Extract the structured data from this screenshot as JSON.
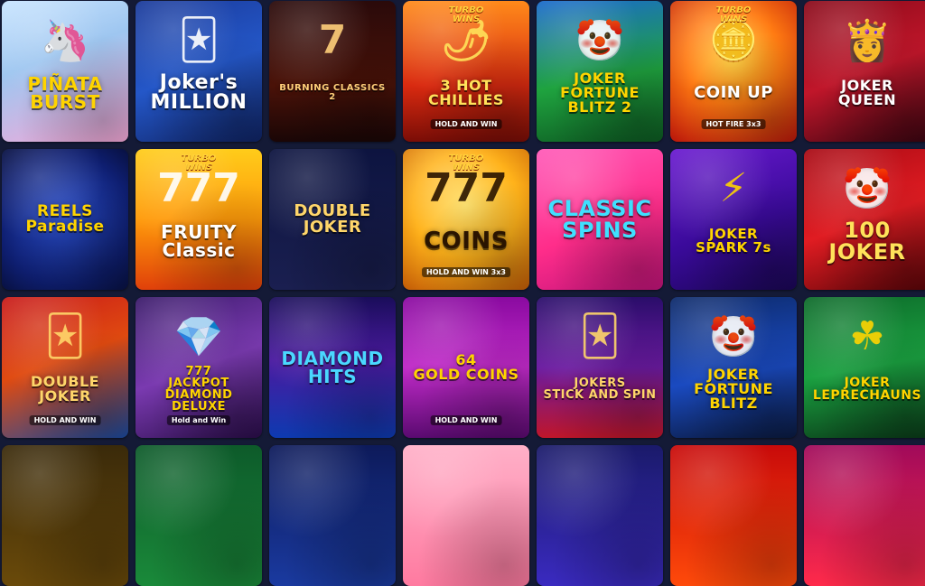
{
  "games": [
    {
      "title": "PIÑATA\nBURST",
      "badge": "",
      "sub": "",
      "bg": "linear-gradient(160deg,#c8e4ff 0%,#9ec6f0 40%,#f6a8d8 100%)",
      "fg": "#ffd400",
      "size": 20,
      "icon": "piñata-icon",
      "glyph": "🦄"
    },
    {
      "title": "Joker's\nMILLION",
      "badge": "",
      "sub": "",
      "bg": "linear-gradient(160deg,#1a3a9a 0%,#2457c8 50%,#0f2364 100%)",
      "fg": "#ffffff",
      "size": 22,
      "icon": "jester-icon",
      "glyph": "🃏"
    },
    {
      "title": "BURNING CLASSICS 2",
      "badge": "",
      "sub": "",
      "bg": "linear-gradient(180deg,#2a0a0a 0%,#4a1208 60%,#1a0606 100%)",
      "fg": "#ffcf7a",
      "size": 10,
      "icon": "sevens-icon",
      "glyph": "7"
    },
    {
      "title": "3 HOT\nCHILLIES",
      "badge": "TURBO\nWINS",
      "sub": "HOLD AND WIN",
      "bg": "linear-gradient(180deg,#ff8a1a 0%,#d92a10 60%,#7a0d06 100%)",
      "fg": "#ffe25a",
      "size": 16,
      "icon": "chili-icon",
      "glyph": "🌶"
    },
    {
      "title": "JOKER\nFORTUNE\nBLITZ 2",
      "badge": "",
      "sub": "",
      "bg": "linear-gradient(170deg,#1a6acc 0%,#1fa33f 55%,#0d5a22 100%)",
      "fg": "#ffd400",
      "size": 16,
      "icon": "jester-icon",
      "glyph": "🤡"
    },
    {
      "title": "COIN UP",
      "badge": "TURBO\nWINS",
      "sub": "HOT FIRE 3x3",
      "bg": "radial-gradient(circle at 50% 40%,#ffd23a 0%,#ff7a12 45%,#b8140a 100%)",
      "fg": "#ffffff",
      "size": 18,
      "icon": "coin-icon",
      "glyph": "🪙"
    },
    {
      "title": "JOKER\nQUEEN",
      "badge": "",
      "sub": "",
      "bg": "linear-gradient(160deg,#8a0a1a 0%,#c0162a 50%,#3a0410 100%)",
      "fg": "#ffffff",
      "size": 16,
      "icon": "queen-icon",
      "glyph": "👸"
    },
    {
      "title": "REELS\nParadise",
      "badge": "",
      "sub": "",
      "bg": "radial-gradient(circle at 50% 50%,#2a4fd0 0%,#0e1e70 70%,#081040 100%)",
      "fg": "#ffd400",
      "size": 17,
      "icon": "reel-icon",
      "glyph": ""
    },
    {
      "title": "FRUITY\nClassic",
      "badge": "TURBO\nWINS",
      "sub": "",
      "bg": "linear-gradient(180deg,#ffcc1a 0%,#ff9a0a 50%,#e0400a 100%)",
      "fg": "#ffffff",
      "size": 20,
      "icon": "sevens-icon",
      "glyph": "777"
    },
    {
      "title": "DOUBLE\nJOKER",
      "badge": "",
      "sub": "",
      "bg": "linear-gradient(180deg,#0d1440 0%,#1a1f50 100%)",
      "fg": "#ffd66a",
      "size": 18,
      "icon": "jester-icon",
      "glyph": ""
    },
    {
      "title": "COINS",
      "badge": "TURBO\nWINS",
      "sub": "HOLD AND WIN 3x3",
      "bg": "radial-gradient(circle at 50% 40%,#ffe066 0%,#ffb21a 50%,#c25a06 100%)",
      "fg": "#2a1400",
      "size": 26,
      "icon": "coin-icon",
      "glyph": "777"
    },
    {
      "title": "CLASSIC\nSPINS",
      "badge": "",
      "sub": "",
      "bg": "linear-gradient(160deg,#ff5ab8 0%,#ff2d8a 55%,#c2137a 100%)",
      "fg": "#3fe0ff",
      "size": 24,
      "icon": "spin-icon",
      "glyph": ""
    },
    {
      "title": "JOKER\nSPARK 7s",
      "badge": "",
      "sub": "",
      "bg": "linear-gradient(160deg,#6a1ad0 0%,#3a0a9a 55%,#1a0656 100%)",
      "fg": "#ffd400",
      "size": 15,
      "icon": "jester-icon",
      "glyph": "⚡"
    },
    {
      "title": "100\nJOKER",
      "badge": "",
      "sub": "",
      "bg": "linear-gradient(160deg,#a80a14 0%,#e01c22 50%,#5a0408 100%)",
      "fg": "#ffe25a",
      "size": 24,
      "icon": "clown-icon",
      "glyph": "🤡"
    },
    {
      "title": "DOUBLE\nJOKER",
      "badge": "",
      "sub": "HOLD AND WIN",
      "bg": "linear-gradient(160deg,#c81a1a 0%,#e04a10 45%,#1a4aa0 100%)",
      "fg": "#ffd66a",
      "size": 16,
      "icon": "jester-icon",
      "glyph": "🃏"
    },
    {
      "title": "777\nJACKPOT\nDIAMOND\nDELUXE",
      "badge": "",
      "sub": "Hold and Win",
      "bg": "linear-gradient(160deg,#3a1a6a 0%,#7a3ab0 50%,#2a0d4a 100%)",
      "fg": "#ffd400",
      "size": 13,
      "icon": "diamond-icon",
      "glyph": "💎"
    },
    {
      "title": "DIAMOND\nHITS",
      "badge": "",
      "sub": "",
      "bg": "linear-gradient(180deg,#1a0d5a 0%,#4a1aa0 45%,#0d3ab0 100%)",
      "fg": "#4ad8ff",
      "size": 20,
      "icon": "diamond-icon",
      "glyph": ""
    },
    {
      "title": "64\nGOLD COINS",
      "badge": "",
      "sub": "HOLD AND WIN",
      "bg": "linear-gradient(180deg,#8a0aa0 0%,#c02ac8 50%,#5a0a70 100%)",
      "fg": "#ffd400",
      "size": 16,
      "icon": "coin-icon",
      "glyph": ""
    },
    {
      "title": "JOKERS\nSTICK AND SPIN",
      "badge": "",
      "sub": "",
      "bg": "linear-gradient(180deg,#2a0d6a 0%,#6a1aa0 50%,#c0162a 100%)",
      "fg": "#ffd66a",
      "size": 13,
      "icon": "jester-icon",
      "glyph": "🃏"
    },
    {
      "title": "JOKER\nFORTUNE\nBLITZ",
      "badge": "",
      "sub": "",
      "bg": "linear-gradient(170deg,#0d2a6a 0%,#1a4ac0 55%,#0a1a40 100%)",
      "fg": "#ffd400",
      "size": 16,
      "icon": "jester-icon",
      "glyph": "🤡"
    },
    {
      "title": "JOKER\nLEPRECHAUNS",
      "badge": "",
      "sub": "",
      "bg": "linear-gradient(170deg,#0d6a2a 0%,#1aa040 50%,#0a3a18 100%)",
      "fg": "#ffd400",
      "size": 14,
      "icon": "leprechaun-icon",
      "glyph": "☘"
    },
    {
      "title": "",
      "badge": "",
      "sub": "",
      "bg": "linear-gradient(180deg,#3a2a0a 0%,#6a4a0a 100%)",
      "fg": "#ffd400",
      "size": 14,
      "icon": "coin-icon",
      "glyph": ""
    },
    {
      "title": "",
      "badge": "",
      "sub": "",
      "bg": "linear-gradient(180deg,#0d5a2a 0%,#1a8a3a 100%)",
      "fg": "#ffd400",
      "size": 14,
      "icon": "leaf-icon",
      "glyph": ""
    },
    {
      "title": "",
      "badge": "",
      "sub": "",
      "bg": "linear-gradient(180deg,#0d1a5a 0%,#1a3aa0 100%)",
      "fg": "#ffd400",
      "size": 14,
      "icon": "star-icon",
      "glyph": ""
    },
    {
      "title": "",
      "badge": "",
      "sub": "",
      "bg": "linear-gradient(180deg,#ffb0c8 0%,#ff7aa0 100%)",
      "fg": "#ffd400",
      "size": 14,
      "icon": "candy-icon",
      "glyph": ""
    },
    {
      "title": "",
      "badge": "",
      "sub": "",
      "bg": "linear-gradient(180deg,#1a1a6a 0%,#3a2ac0 100%)",
      "fg": "#ffd400",
      "size": 14,
      "icon": "gem-icon",
      "glyph": ""
    },
    {
      "title": "",
      "badge": "",
      "sub": "",
      "bg": "linear-gradient(180deg,#c80a0a 0%,#ff4a0a 100%)",
      "fg": "#ffd400",
      "size": 14,
      "icon": "fire-icon",
      "glyph": ""
    },
    {
      "title": "",
      "badge": "",
      "sub": "",
      "bg": "linear-gradient(180deg,#a00a5a 0%,#ff2a4a 100%)",
      "fg": "#ffd400",
      "size": 14,
      "icon": "heart-icon",
      "glyph": ""
    }
  ]
}
